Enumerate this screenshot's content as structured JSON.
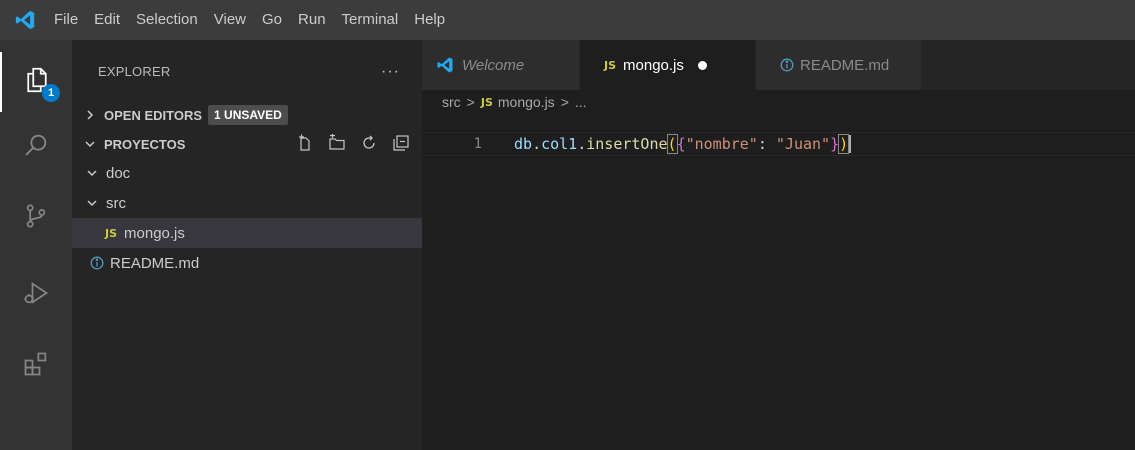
{
  "menu": [
    "File",
    "Edit",
    "Selection",
    "View",
    "Go",
    "Run",
    "Terminal",
    "Help"
  ],
  "activity": {
    "explorer_badge": "1",
    "icons": [
      "files-icon",
      "search-icon",
      "source-control-icon",
      "run-debug-icon",
      "extensions-icon"
    ]
  },
  "sidebar": {
    "title": "EXPLORER",
    "more": "···",
    "open_editors": {
      "label": "OPEN EDITORS",
      "badge": "1 UNSAVED"
    },
    "folder": {
      "label": "PROYECTOS"
    },
    "tree": [
      {
        "label": "doc",
        "type": "folder"
      },
      {
        "label": "src",
        "type": "folder"
      },
      {
        "label": "mongo.js",
        "type": "js",
        "icon_label": "JS"
      },
      {
        "label": "README.md",
        "type": "info"
      }
    ]
  },
  "editor": {
    "tabs": [
      {
        "label": "Welcome"
      },
      {
        "label": "mongo.js",
        "icon_label": "JS"
      },
      {
        "label": "README.md"
      }
    ],
    "breadcrumbs": {
      "folder": "src",
      "js": "JS",
      "file": "mongo.js",
      "sep": ">",
      "more": "..."
    },
    "line_number": "1",
    "code": {
      "obj": "db",
      "dot1": ".",
      "coll": "col1",
      "dot2": ".",
      "fn": "insertOne",
      "paren_open": "(",
      "brace_open": "{",
      "key": "\"nombre\"",
      "colon": ": ",
      "value": "\"Juan\"",
      "brace_close": "}",
      "paren_close": ")"
    }
  },
  "colors": {
    "accent": "#007acc",
    "vscode_blue": "#23a9f2",
    "js_yellow": "#cbcb41",
    "info_blue": "#519aba"
  }
}
